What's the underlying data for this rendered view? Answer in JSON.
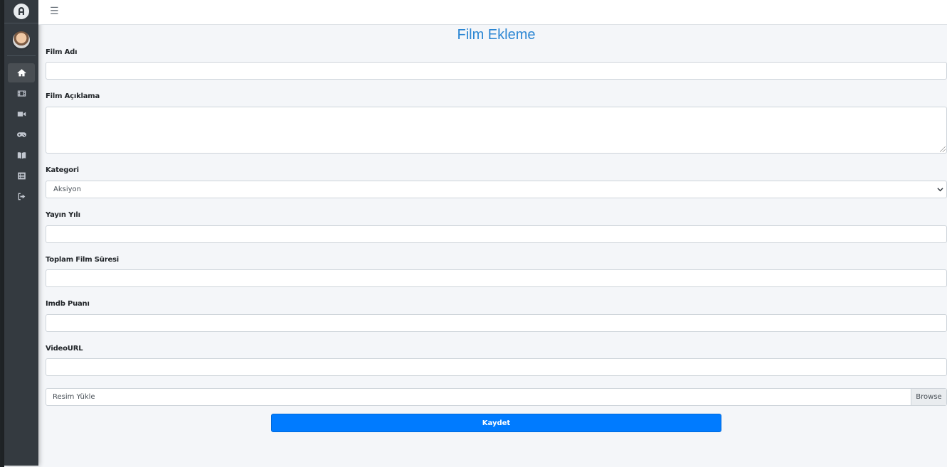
{
  "topbar": {
    "menu_icon": "hamburger-icon"
  },
  "sidebar": {
    "logo_icon": "brand-logo-icon",
    "items": [
      {
        "icon": "home-icon",
        "active": true
      },
      {
        "icon": "film-icon",
        "active": false
      },
      {
        "icon": "video-camera-icon",
        "active": false
      },
      {
        "icon": "gamepad-icon",
        "active": false
      },
      {
        "icon": "book-icon",
        "active": false
      },
      {
        "icon": "list-icon",
        "active": false
      },
      {
        "icon": "sign-out-icon",
        "active": false
      }
    ]
  },
  "page": {
    "title": "Film Ekleme"
  },
  "form": {
    "film_adi_label": "Film Adı",
    "film_aciklama_label": "Film Açıklama",
    "kategori_label": "Kategori",
    "kategori_value": "Aksiyon",
    "yayin_yili_label": "Yayın Yılı",
    "toplam_sure_label": "Toplam Film Süresi",
    "imdb_label": "Imdb Puanı",
    "video_url_label": "VideoURL",
    "resim_placeholder": "Resim Yükle",
    "browse_label": "Browse",
    "submit_label": "Kaydet"
  },
  "colors": {
    "accent": "#007bff",
    "title": "#2b86d3",
    "sidebar": "#343a40"
  }
}
